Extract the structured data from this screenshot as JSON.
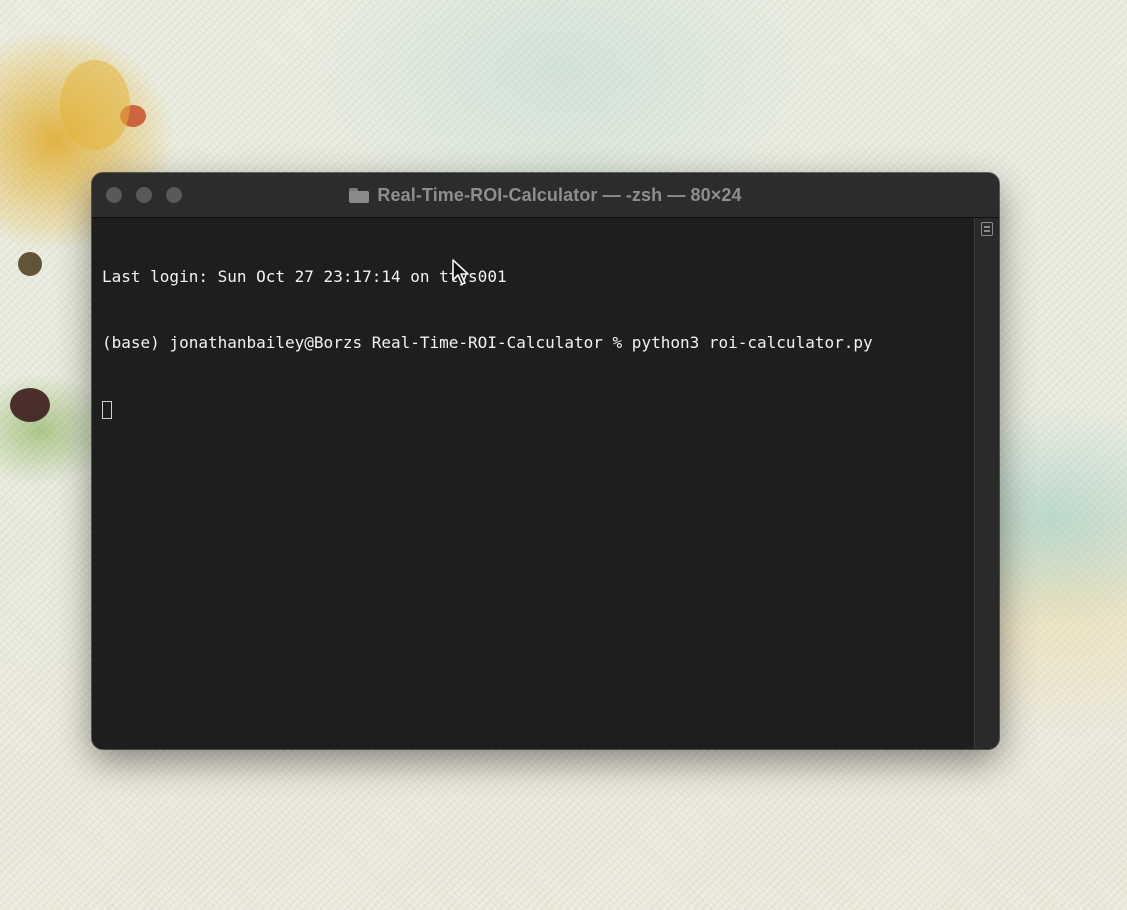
{
  "window": {
    "title": "Real-Time-ROI-Calculator — -zsh — 80×24",
    "title_icon": "folder-icon",
    "buttons": [
      "close",
      "minimize",
      "zoom"
    ]
  },
  "terminal": {
    "lines": [
      "Last login: Sun Oct 27 23:17:14 on ttys001",
      "(base) jonathanbailey@Borzs Real-Time-ROI-Calculator % python3 roi-calculator.py"
    ],
    "background": "#1e1e1e",
    "text_color": "#f2f2f2"
  },
  "icons": {
    "scroll_marker": "scroll-marker-icon",
    "mouse_cursor": "mouse-cursor-icon"
  }
}
